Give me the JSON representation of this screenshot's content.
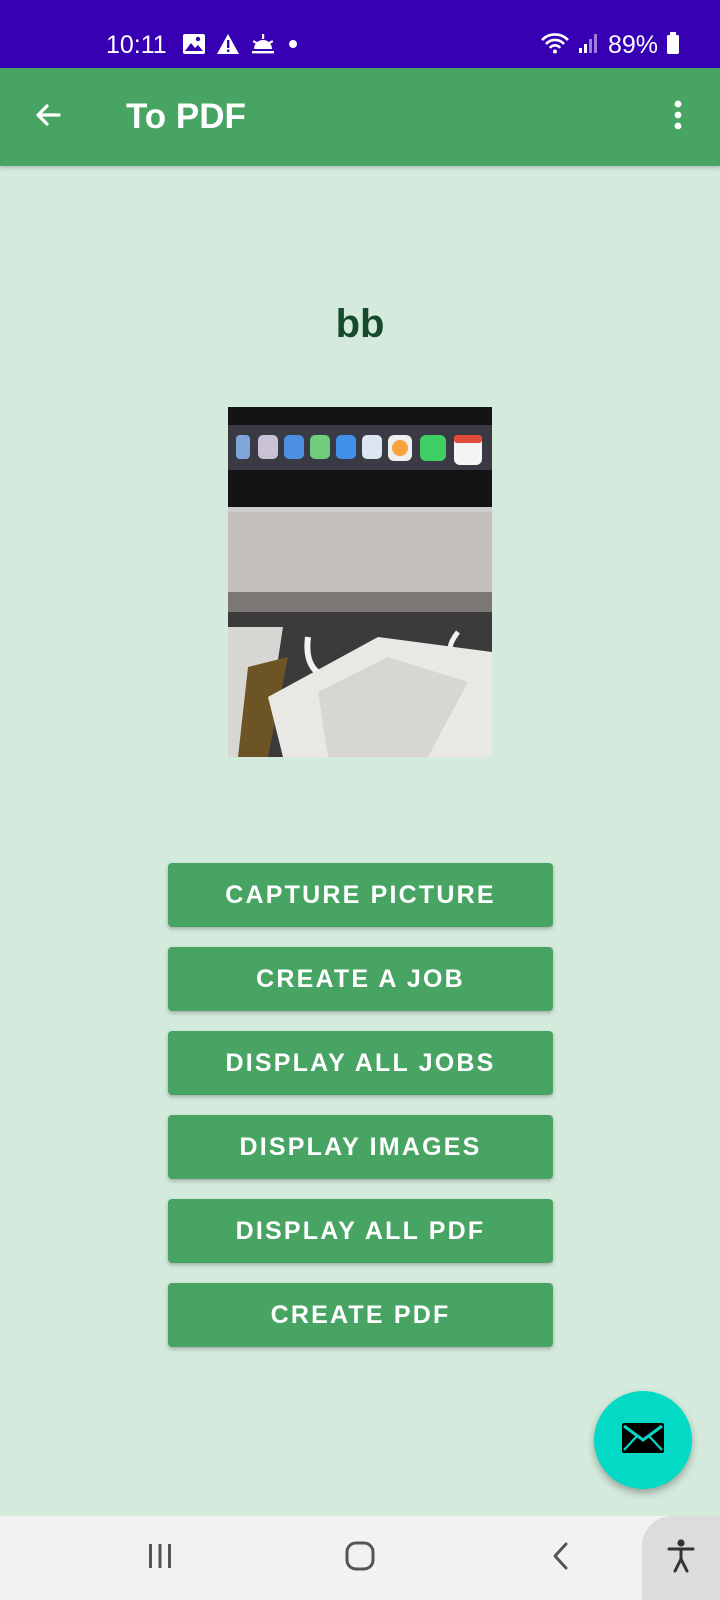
{
  "status_bar": {
    "time": "10:11",
    "battery": "89%",
    "icons": [
      "gallery-icon",
      "warning-icon",
      "sunrise-icon",
      "dot-icon",
      "wifi-icon",
      "signal-icon",
      "battery-icon"
    ]
  },
  "app_bar": {
    "title": "To PDF",
    "back_icon": "arrow-back-icon",
    "menu_icon": "more-vert-icon"
  },
  "job": {
    "name": "bb",
    "photo_icon": "photo-of-laptop-desk"
  },
  "buttons": [
    {
      "label": "CAPTURE PICTURE"
    },
    {
      "label": "CREATE A JOB"
    },
    {
      "label": "DISPLAY ALL JOBS"
    },
    {
      "label": "DISPLAY IMAGES"
    },
    {
      "label": "DISPLAY ALL PDF"
    },
    {
      "label": "CREATE PDF"
    }
  ],
  "fab": {
    "icon": "email-icon",
    "color": "#03dac5"
  },
  "nav_bar": {
    "icons": [
      "recents-icon",
      "home-icon",
      "back-icon",
      "accessibility-icon"
    ]
  },
  "colors": {
    "status_bar": "#3700b3",
    "primary": "#48a463",
    "background": "#d4eadc",
    "title_text": "#164a2d"
  }
}
